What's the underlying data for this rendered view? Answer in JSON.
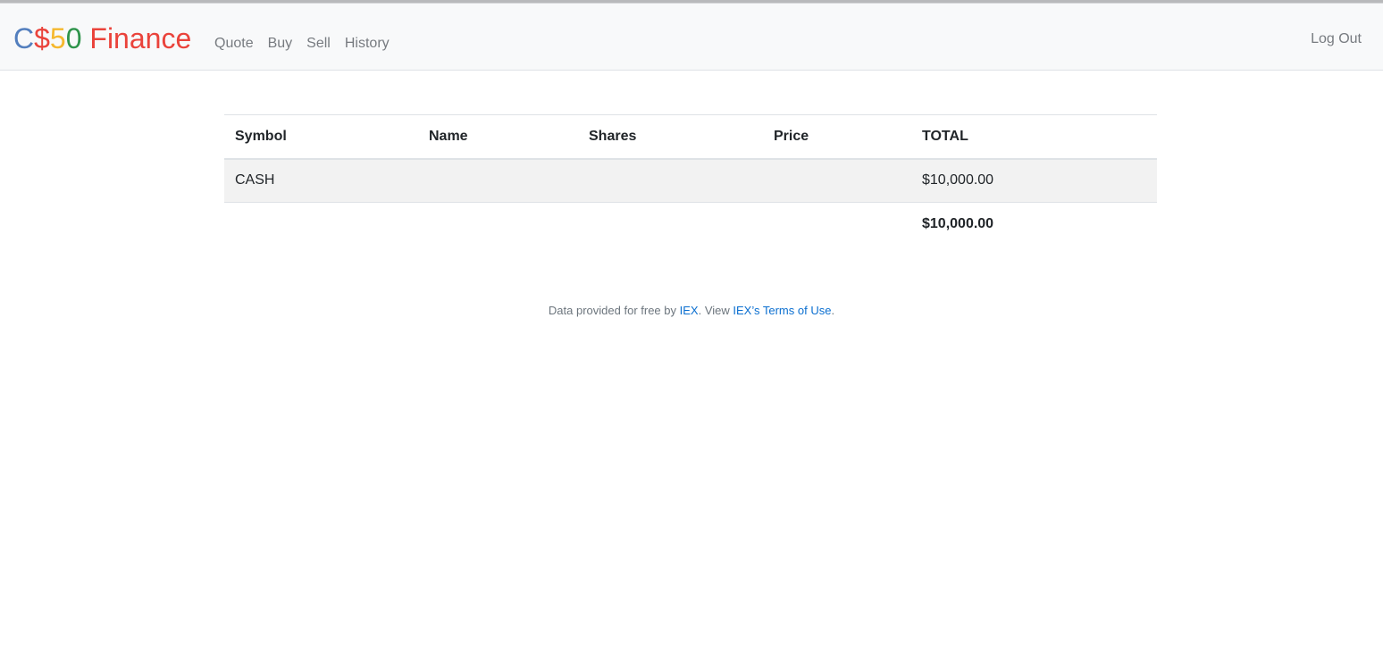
{
  "brand": {
    "part1": "C",
    "part2": "$",
    "part3": "5",
    "part4": "0",
    "part5": " Finance",
    "colors": {
      "blue": "#537fbe",
      "red": "#ea433b",
      "yellow": "#f5b82e",
      "green": "#2e944b"
    }
  },
  "nav": {
    "items": [
      {
        "label": "Quote"
      },
      {
        "label": "Buy"
      },
      {
        "label": "Sell"
      },
      {
        "label": "History"
      }
    ],
    "logout_label": "Log Out"
  },
  "table": {
    "headers": [
      "Symbol",
      "Name",
      "Shares",
      "Price",
      "TOTAL"
    ],
    "rows": [
      {
        "symbol": "CASH",
        "name": "",
        "shares": "",
        "price": "",
        "total": "$10,000.00"
      }
    ],
    "grand_total": "$10,000.00"
  },
  "footer": {
    "prefix": "Data provided for free by ",
    "link1": "IEX",
    "middle": ". View ",
    "link2": "IEX’s Terms of Use",
    "suffix": "."
  }
}
